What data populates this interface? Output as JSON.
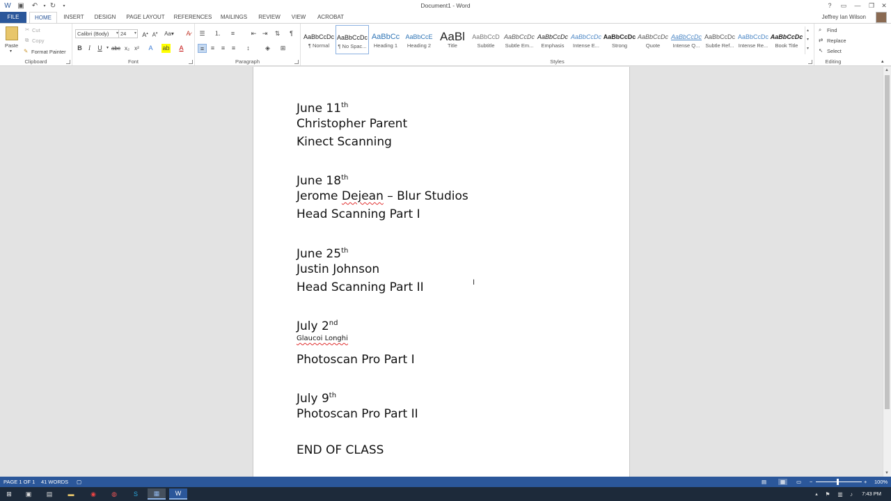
{
  "titlebar": {
    "title": "Document1 - Word",
    "quick_access": [
      "word-icon",
      "save-icon",
      "undo-icon",
      "redo-icon",
      "customize-icon"
    ]
  },
  "tabs": {
    "file": "FILE",
    "items": [
      "HOME",
      "INSERT",
      "DESIGN",
      "PAGE LAYOUT",
      "REFERENCES",
      "MAILINGS",
      "REVIEW",
      "VIEW",
      "ACROBAT"
    ],
    "active": "HOME"
  },
  "user": {
    "name": "Jeffrey Ian Wilson"
  },
  "clipboard": {
    "label": "Clipboard",
    "paste": "Paste",
    "cut": "Cut",
    "copy": "Copy",
    "format_painter": "Format Painter"
  },
  "font": {
    "label": "Font",
    "family": "Calibri (Body)",
    "size": "24"
  },
  "paragraph": {
    "label": "Paragraph"
  },
  "styles": {
    "label": "Styles",
    "items": [
      {
        "preview": "AaBbCcDc",
        "name": "¶ Normal"
      },
      {
        "preview": "AaBbCcDc",
        "name": "¶ No Spac..."
      },
      {
        "preview": "AaBbCc",
        "name": "Heading 1"
      },
      {
        "preview": "AaBbCcE",
        "name": "Heading 2"
      },
      {
        "preview": "AaBl",
        "name": "Title"
      },
      {
        "preview": "AaBbCcD",
        "name": "Subtitle"
      },
      {
        "preview": "AaBbCcDc",
        "name": "Subtle Em..."
      },
      {
        "preview": "AaBbCcDc",
        "name": "Emphasis"
      },
      {
        "preview": "AaBbCcDc",
        "name": "Intense E..."
      },
      {
        "preview": "AaBbCcDc",
        "name": "Strong"
      },
      {
        "preview": "AaBbCcDc",
        "name": "Quote"
      },
      {
        "preview": "AaBbCcDc",
        "name": "Intense Q..."
      },
      {
        "preview": "AaBbCcDc",
        "name": "Subtle Ref..."
      },
      {
        "preview": "AaBbCcDc",
        "name": "Intense Re..."
      },
      {
        "preview": "AaBbCcDc",
        "name": "Book Title"
      }
    ]
  },
  "editing": {
    "label": "Editing",
    "find": "Find",
    "replace": "Replace",
    "select": "Select"
  },
  "document": {
    "june11": {
      "text": "June 11",
      "sup": "th"
    },
    "l2": "Christopher Parent",
    "l3": "Kinect Scanning",
    "june18": {
      "text": "June 18",
      "sup": "th"
    },
    "l5_name": "Jerome",
    "l5_misspelled": "Dejean",
    "l5_rest": " – Blur Studios",
    "l6": "Head Scanning Part I",
    "june25": {
      "text": "June 25",
      "sup": "th"
    },
    "l8": "Justin Johnson",
    "l9": "Head Scanning Part II",
    "july2": {
      "text": "July 2",
      "sup": "nd"
    },
    "l11": "Glaucoi Longhi",
    "l12": "Photoscan Pro Part I",
    "july9": {
      "text": "July 9",
      "sup": "th"
    },
    "l14": "Photoscan Pro Part II",
    "l15": "END OF CLASS"
  },
  "statusbar": {
    "page": "PAGE 1 OF 1",
    "words": "41 WORDS",
    "zoom": "100%"
  },
  "taskbar": {
    "time": "7:43 PM"
  }
}
